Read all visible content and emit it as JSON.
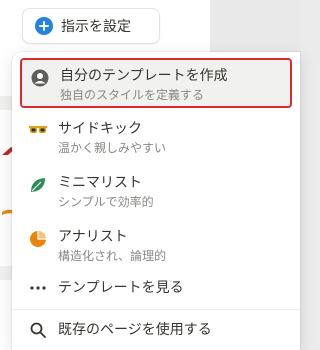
{
  "top_button": {
    "label": "指示を設定"
  },
  "menu": {
    "items": [
      {
        "title": "自分のテンプレートを作成",
        "description": "独自のスタイルを定義する",
        "icon": "user-circle-icon"
      },
      {
        "title": "サイドキック",
        "description": "温かく親しみやすい",
        "icon": "sunglasses-icon"
      },
      {
        "title": "ミニマリスト",
        "description": "シンプルで効率的",
        "icon": "leaf-icon"
      },
      {
        "title": "アナリスト",
        "description": "構造化され、論理的",
        "icon": "pie-chart-icon"
      }
    ],
    "actions": [
      {
        "label": "テンプレートを見る",
        "icon": "ellipsis-icon"
      },
      {
        "label": "既存のページを使用する",
        "icon": "search-icon"
      }
    ]
  },
  "colors": {
    "accent_blue": "#2383e2",
    "highlight_border": "#e0282f",
    "sunglasses": "#d9a21b",
    "leaf": "#2e8b57",
    "pie": "#e8860c"
  }
}
